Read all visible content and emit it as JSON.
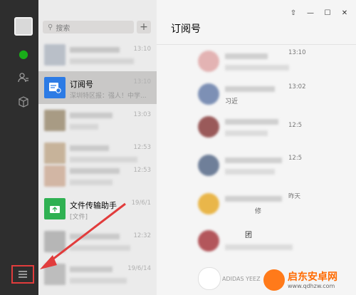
{
  "search": {
    "placeholder": "搜索",
    "add_label": "+"
  },
  "chat_list": [
    {
      "name": "",
      "preview": "",
      "time": "13:10",
      "blurred": true
    },
    {
      "name": "订阅号",
      "preview": "深圳特区报：强人！中学...",
      "time": "13:10",
      "active": true,
      "blurred": false
    },
    {
      "name": "",
      "preview": "",
      "time": "13:03",
      "blurred": true
    },
    {
      "name": "",
      "preview": "",
      "time": "12:53",
      "blurred": true
    },
    {
      "name": "",
      "preview": "",
      "time": "12:53",
      "blurred": true
    },
    {
      "name": "文件传输助手",
      "preview": "[文件]",
      "time": "19/6/1",
      "blurred": false
    },
    {
      "name": "",
      "preview": "",
      "time": "12:32",
      "blurred": true
    },
    {
      "name": "",
      "preview": "",
      "time": "19/6/14",
      "blurred": true
    }
  ],
  "pane": {
    "title": "订阅号",
    "window_buttons": [
      "⇧",
      "—",
      "☐",
      "✕"
    ],
    "feed": [
      {
        "time": "13:10",
        "text": ""
      },
      {
        "time": "13:02",
        "text": "习近"
      },
      {
        "time": "12:5",
        "text": ""
      },
      {
        "time": "12:5",
        "text": ""
      },
      {
        "time": "昨天",
        "text": "修"
      },
      {
        "time": "",
        "text": "团"
      },
      {
        "time": "",
        "text": "ADIDAS YEEZ"
      }
    ]
  },
  "watermark": {
    "title": "启东安卓网",
    "url": "www.qdhzw.com"
  },
  "colors": {
    "rail": "#2e2e2e",
    "list_bg": "#ebebeb",
    "active": "#c9c8c7",
    "accent_green": "#19ad19",
    "annotation_red": "#e13c3c"
  }
}
